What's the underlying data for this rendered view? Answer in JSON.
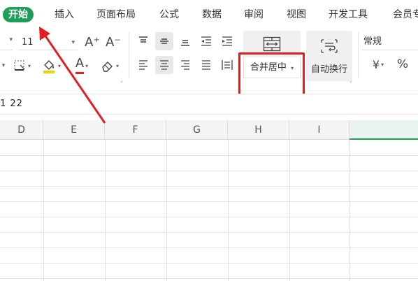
{
  "menu": {
    "items": [
      {
        "name": "menu-tab-start",
        "label": "开始",
        "active": true
      },
      {
        "name": "menu-tab-insert",
        "label": "插入"
      },
      {
        "name": "menu-tab-page-layout",
        "label": "页面布局"
      },
      {
        "name": "menu-tab-formulas",
        "label": "公式"
      },
      {
        "name": "menu-tab-data",
        "label": "数据"
      },
      {
        "name": "menu-tab-review",
        "label": "审阅"
      },
      {
        "name": "menu-tab-view",
        "label": "视图"
      },
      {
        "name": "menu-tab-developer",
        "label": "开发工具"
      },
      {
        "name": "menu-tab-member",
        "label": "会员专"
      }
    ]
  },
  "toolbar": {
    "font_size": "11",
    "increase_font_glyph": "A⁺",
    "decrease_font_glyph": "A⁻",
    "font_color_glyph": "A",
    "merge_center_label": "合并居中",
    "wrap_text_label": "自动换行",
    "number_format": "常规",
    "currency_glyph": "¥",
    "percent_glyph": "%",
    "font_color_hex": "#e02020",
    "fill_color_hex": "#f2d500"
  },
  "formula_bar": {
    "content": "1  22"
  },
  "grid": {
    "columns": [
      "D",
      "E",
      "F",
      "G",
      "H",
      "I",
      ""
    ],
    "selected_column": ""
  },
  "colors": {
    "accent": "#1e9e57",
    "annotation": "#e02020"
  }
}
